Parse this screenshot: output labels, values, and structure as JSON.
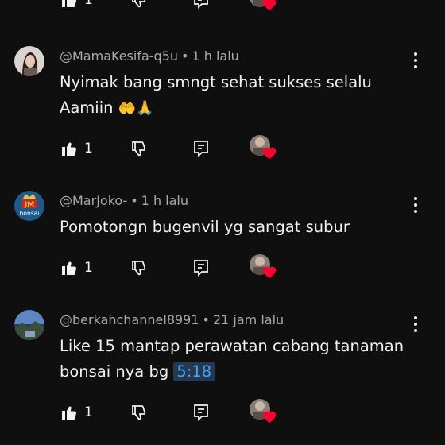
{
  "colors": {
    "background": "#0f0f0f",
    "text": "#f1f1f1",
    "meta": "#aaaaaa",
    "timestamp_bg": "#263850",
    "timestamp_text": "#3ea6ff",
    "heart": "#ff0033"
  },
  "top_row": {
    "like_count": "1"
  },
  "comments": [
    {
      "author": "@MamaKesifa-q5u",
      "age": "1 h lalu",
      "text_line1": "Nyimak bang smngt sehat sukses selalu",
      "text_line2": "Aamiin",
      "emojis": "🤲🙏",
      "like_count": "1",
      "avatar": "woman-portrait"
    },
    {
      "author": "@MarJoko-",
      "age": "1 h lalu",
      "text_line1": "Pomotongn bugenvil yg sangat subur",
      "like_count": "1",
      "avatar": "jm-bonsai-logo",
      "avatar_logo_text": "JM",
      "avatar_logo_sub": "bonsai"
    },
    {
      "author": "@berkahchannel8991",
      "age": "21 jam lalu",
      "text_line1": "Like 15 mantap perawatan cabang tanaman",
      "text_line2": "bonsai nya bg",
      "timestamp_link": "5:18",
      "like_count": "1",
      "avatar": "landscape-photo"
    }
  ],
  "separator": "•"
}
